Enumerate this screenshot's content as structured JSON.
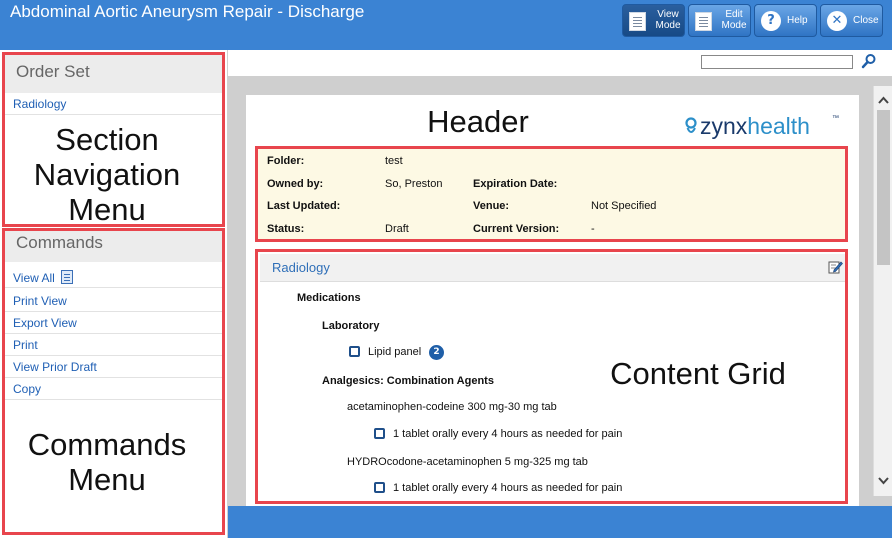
{
  "window": {
    "title": "Abdominal Aortic Aneurysm Repair - Discharge",
    "accent_color": "#3b83d3",
    "annotation_color": "#e8454d"
  },
  "toolbar": {
    "view_mode": {
      "line1": "View",
      "line2": "Mode",
      "icon": "document-icon",
      "active": true
    },
    "edit_mode": {
      "line1": "Edit",
      "line2": "Mode",
      "icon": "edit-document-icon"
    },
    "help": {
      "label": "Help",
      "icon": "question-icon"
    },
    "close": {
      "label": "Close",
      "icon": "close-icon"
    }
  },
  "sidebar": {
    "section_title": "Order Set",
    "section_items": [
      {
        "label": "Radiology"
      }
    ],
    "commands_title": "Commands",
    "commands": [
      {
        "label": "View All",
        "icon": "document-list-icon"
      },
      {
        "label": "Print View"
      },
      {
        "label": "Export View"
      },
      {
        "label": "Print"
      },
      {
        "label": "View Prior Draft"
      },
      {
        "label": "Copy"
      }
    ]
  },
  "search": {
    "value": "",
    "placeholder": ""
  },
  "annotations": {
    "section_nav": [
      "Section",
      "Navigation",
      "Menu"
    ],
    "commands_menu": [
      "Commands",
      "Menu"
    ],
    "header": "Header",
    "content_grid": "Content Grid"
  },
  "logo": {
    "text": "zynxhealth",
    "tm": "™"
  },
  "info": {
    "folder_label": "Folder:",
    "folder_value": "test",
    "owned_by_label": "Owned by:",
    "owned_by_value": "So, Preston",
    "expiration_label": "Expiration Date:",
    "expiration_value": "",
    "last_updated_label": "Last Updated:",
    "last_updated_value": "",
    "venue_label": "Venue:",
    "venue_value": "Not Specified",
    "status_label": "Status:",
    "status_value": "Draft",
    "current_version_label": "Current Version:",
    "current_version_value": "-"
  },
  "content": {
    "section_title": "Radiology",
    "medications_heading": "Medications",
    "laboratory_heading": "Laboratory",
    "lipid_panel": {
      "label": "Lipid panel",
      "count": "2"
    },
    "analgesics_heading": "Analgesics: Combination Agents",
    "drug1_name": "acetaminophen-codeine 300 mg-30 mg tab",
    "drug1_order": "1 tablet orally every 4 hours as needed for pain",
    "drug2_name": "HYDROcodone-acetaminophen 5 mg-325 mg tab",
    "drug2_order": "1 tablet orally every 4 hours as needed for pain"
  }
}
